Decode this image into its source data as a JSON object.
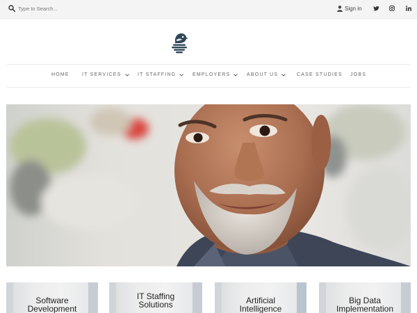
{
  "topbar": {
    "search_placeholder": "Type to Search...",
    "sign_in": "Sign in",
    "social": [
      "twitter-icon",
      "instagram-icon",
      "linkedin-icon"
    ]
  },
  "brand": {
    "accent": "#2f4656"
  },
  "nav": {
    "items": [
      {
        "label": "HOME",
        "dropdown": false
      },
      {
        "label": "IT SERVICES",
        "dropdown": true
      },
      {
        "label": "IT STAFFING",
        "dropdown": true
      },
      {
        "label": "EMPLOYERS",
        "dropdown": true
      },
      {
        "label": "ABOUT US",
        "dropdown": true
      },
      {
        "label": "CASE STUDIES",
        "dropdown": false
      },
      {
        "label": "JOBS",
        "dropdown": false
      }
    ]
  },
  "cards": [
    {
      "line1": "Software",
      "line2": "Development"
    },
    {
      "line1": "IT Staffing",
      "line2": "Solutions"
    },
    {
      "line1": "Artificial",
      "line2": "Intelligence"
    },
    {
      "line1": "Big Data",
      "line2": "Implementation"
    }
  ]
}
